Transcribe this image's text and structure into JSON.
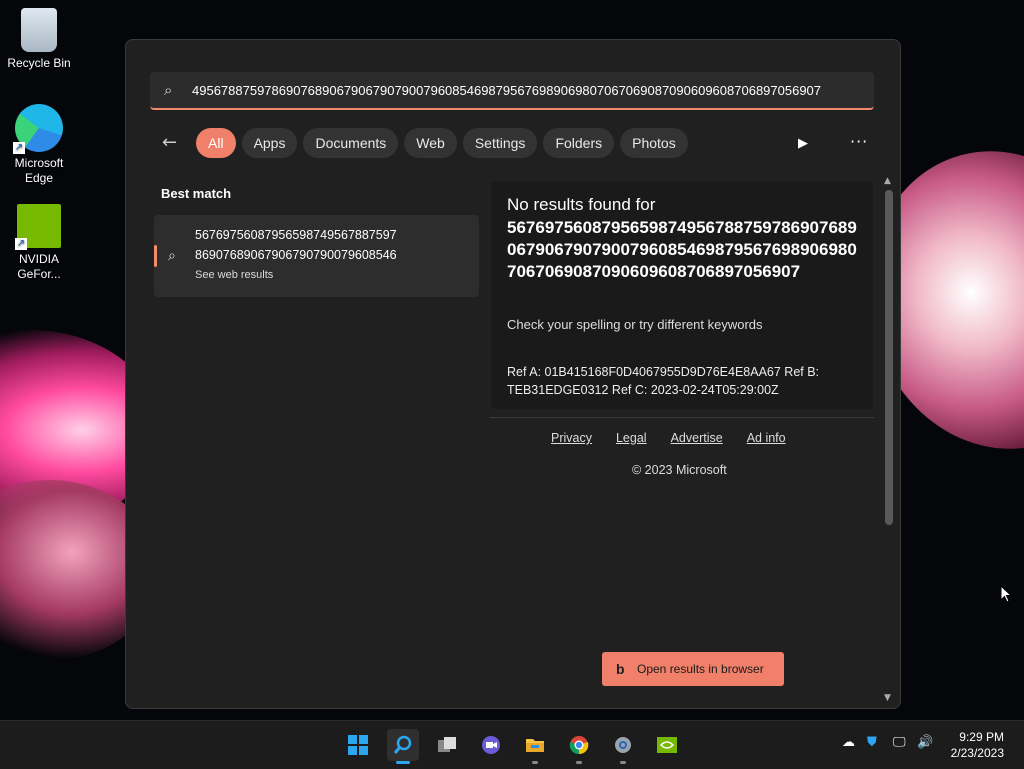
{
  "desktop": {
    "icons": [
      {
        "label": "Recycle Bin"
      },
      {
        "label": "Microsoft Edge"
      },
      {
        "label": "NVIDIA GeFor..."
      }
    ]
  },
  "search": {
    "query": "4956788759786907689067906790790079608546987956769890698070670690870906096087068970569 07",
    "query_display": "49567887597869076890679067907900796085469879567698906980706706908709060960870689705690 7",
    "query_full": "495678875978690768906790679079007960854698795676989069807067069087090609608706897056907"
  },
  "filters": {
    "tabs": [
      "All",
      "Apps",
      "Documents",
      "Web",
      "Settings",
      "Folders",
      "Photos"
    ],
    "active": "All"
  },
  "best_match": {
    "heading": "Best match",
    "line1": "5676975608795659874956788759 7",
    "line1_full": "567697560879565987495678875 97",
    "text_line1": "56769756087956598749567887597",
    "text_line2": "869076890679067907900796085 46",
    "text_line2_full": "8690768906790679079007960854 6",
    "line2": "86907689067906790790079608546",
    "sub": "See web results"
  },
  "results": {
    "no_results_title": "No results found for",
    "query_text": "567697560879565987495678875978690768906790679079007960854698795676989069807067069087090609608706897056907",
    "hint": "Check your spelling or try different keywords",
    "ref": "Ref A: 01B415168F0D4067955D9D76E4E8AA67 Ref B: TEB31EDGE0312 Ref C: 2023-02-24T05:29:00Z",
    "footer_links": [
      "Privacy",
      "Legal",
      "Advertise",
      "Ad info"
    ],
    "copyright": "© 2023 Microsoft"
  },
  "open_button": {
    "label": "Open results in browser"
  },
  "taskbar": {
    "time": "9:29 PM",
    "date": "2/23/2023"
  },
  "colors": {
    "accent": "#f0806a",
    "panel_bg": "#202020"
  }
}
